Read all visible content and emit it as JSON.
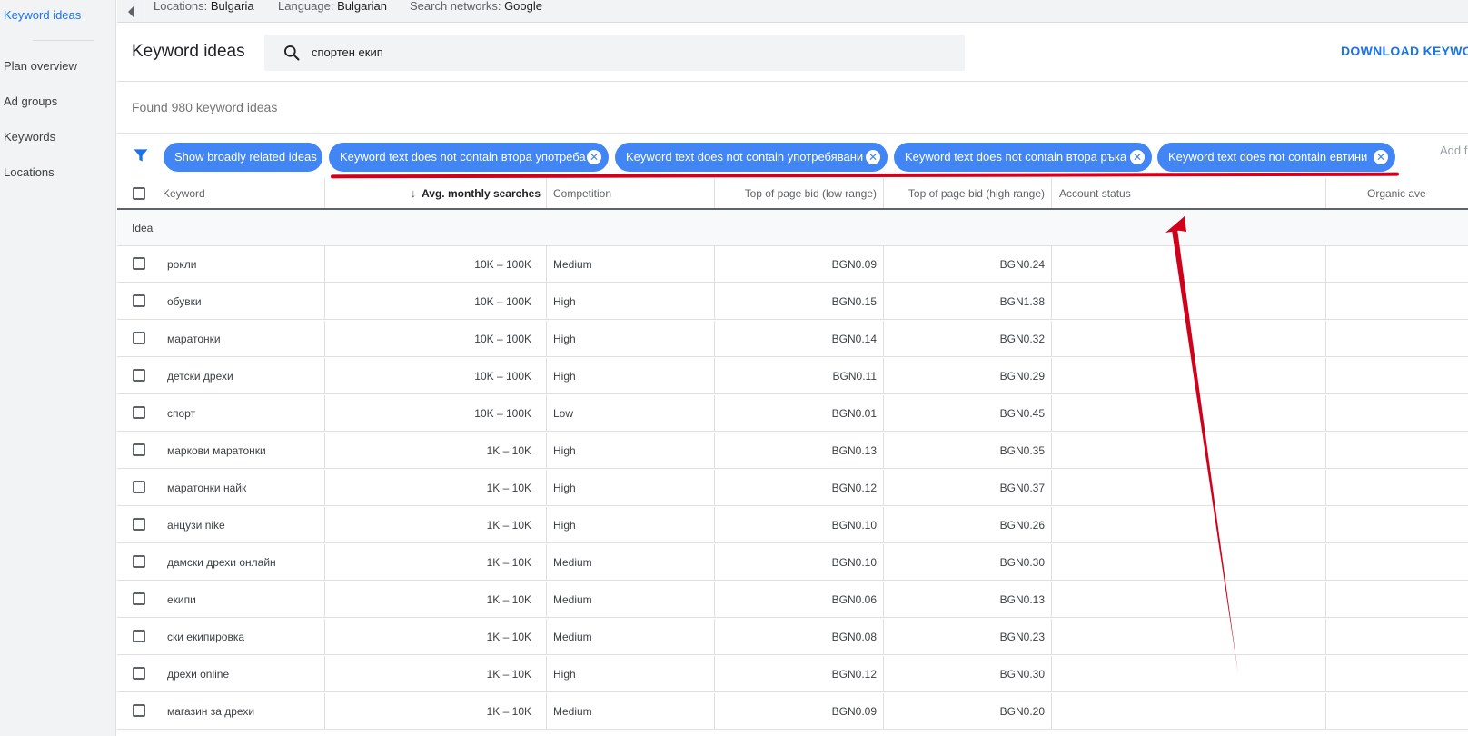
{
  "sidebar": {
    "items": [
      {
        "label": "Keyword ideas",
        "active": true
      },
      {
        "label": "Plan overview"
      },
      {
        "label": "Ad groups"
      },
      {
        "label": "Keywords"
      },
      {
        "label": "Locations"
      }
    ]
  },
  "topbar": {
    "location_label": "Locations:",
    "location_value": "Bulgaria",
    "language_label": "Language:",
    "language_value": "Bulgarian",
    "networks_label": "Search networks:",
    "networks_value": "Google"
  },
  "header": {
    "title": "Keyword ideas",
    "search_value": "спортен екип",
    "download_label": "DOWNLOAD KEYWORD"
  },
  "found_text": "Found 980 keyword ideas",
  "filters": {
    "chips": [
      {
        "label": "Show broadly related ideas",
        "removable": false
      },
      {
        "label": "Keyword text does not contain втора употреба",
        "removable": true
      },
      {
        "label": "Keyword text does not contain употребявани",
        "removable": true
      },
      {
        "label": "Keyword text does not contain втора ръка",
        "removable": true
      },
      {
        "label": "Keyword text does not contain евтини",
        "removable": true
      }
    ],
    "add_filter_label": "Add f"
  },
  "table": {
    "columns": [
      "Keyword",
      "Avg. monthly searches",
      "Competition",
      "Top of page bid (low range)",
      "Top of page bid (high range)",
      "Account status",
      "Organic ave"
    ],
    "group_label": "Idea",
    "rows": [
      [
        "рокли",
        "10K – 100K",
        "Medium",
        "BGN0.09",
        "BGN0.24"
      ],
      [
        "обувки",
        "10K – 100K",
        "High",
        "BGN0.15",
        "BGN1.38"
      ],
      [
        "маратонки",
        "10K – 100K",
        "High",
        "BGN0.14",
        "BGN0.32"
      ],
      [
        "детски дрехи",
        "10K – 100K",
        "High",
        "BGN0.11",
        "BGN0.29"
      ],
      [
        "спорт",
        "10K – 100K",
        "Low",
        "BGN0.01",
        "BGN0.45"
      ],
      [
        "маркови маратонки",
        "1K – 10K",
        "High",
        "BGN0.13",
        "BGN0.35"
      ],
      [
        "маратонки найк",
        "1K – 10K",
        "High",
        "BGN0.12",
        "BGN0.37"
      ],
      [
        "анцузи nike",
        "1K – 10K",
        "High",
        "BGN0.10",
        "BGN0.26"
      ],
      [
        "дамски дрехи онлайн",
        "1K – 10K",
        "Medium",
        "BGN0.10",
        "BGN0.30"
      ],
      [
        "екипи",
        "1K – 10K",
        "Medium",
        "BGN0.06",
        "BGN0.13"
      ],
      [
        "ски екипировка",
        "1K – 10K",
        "Medium",
        "BGN0.08",
        "BGN0.23"
      ],
      [
        "дрехи online",
        "1K – 10K",
        "High",
        "BGN0.12",
        "BGN0.30"
      ],
      [
        "магазин за дрехи",
        "1K – 10K",
        "Medium",
        "BGN0.09",
        "BGN0.20"
      ]
    ]
  },
  "colors": {
    "accent": "#1a73e8",
    "chip": "#4285f4",
    "annotation": "#d0021b"
  }
}
